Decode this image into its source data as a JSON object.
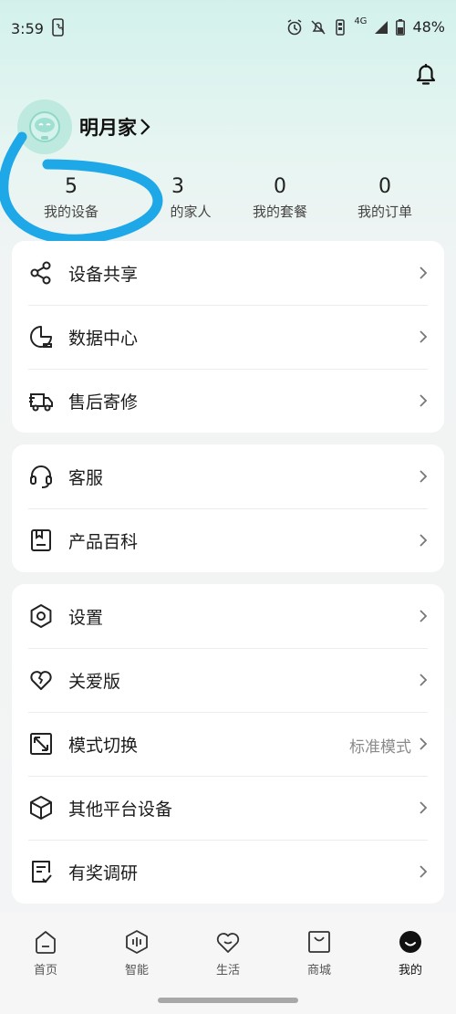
{
  "status_bar": {
    "time": "3:59",
    "network": "4G",
    "battery": "48%",
    "icons": [
      "phone-icon",
      "alarm-icon",
      "mute-icon",
      "vibrate-icon",
      "signal-icon",
      "battery-icon"
    ]
  },
  "header": {
    "bell_icon": "bell-icon"
  },
  "profile": {
    "name": "明月家"
  },
  "stats": [
    {
      "value": "5",
      "label": "我的设备"
    },
    {
      "value": "3",
      "label": "的家人"
    },
    {
      "value": "0",
      "label": "我的套餐"
    },
    {
      "value": "0",
      "label": "我的订单"
    }
  ],
  "card1": [
    {
      "label": "设备共享",
      "icon": "share-icon"
    },
    {
      "label": "数据中心",
      "icon": "data-center-icon"
    },
    {
      "label": "售后寄修",
      "icon": "delivery-truck-icon"
    }
  ],
  "card2": [
    {
      "label": "客服",
      "icon": "headset-icon"
    },
    {
      "label": "产品百科",
      "icon": "book-icon"
    }
  ],
  "card3": [
    {
      "label": "设置",
      "icon": "settings-hexagon-icon"
    },
    {
      "label": "关爱版",
      "icon": "heart-icon"
    },
    {
      "label": "模式切换",
      "icon": "switch-mode-icon",
      "value": "标准模式"
    },
    {
      "label": "其他平台设备",
      "icon": "cube-icon"
    },
    {
      "label": "有奖调研",
      "icon": "survey-icon"
    }
  ],
  "bottom_nav": [
    {
      "label": "首页",
      "icon": "home-icon"
    },
    {
      "label": "智能",
      "icon": "smart-icon"
    },
    {
      "label": "生活",
      "icon": "life-heart-icon"
    },
    {
      "label": "商城",
      "icon": "store-bag-icon"
    },
    {
      "label": "我的",
      "icon": "me-icon",
      "active": true
    }
  ],
  "colors": {
    "accent_scribble": "#1fa8e8",
    "avatar_bg": "#bde9df"
  }
}
